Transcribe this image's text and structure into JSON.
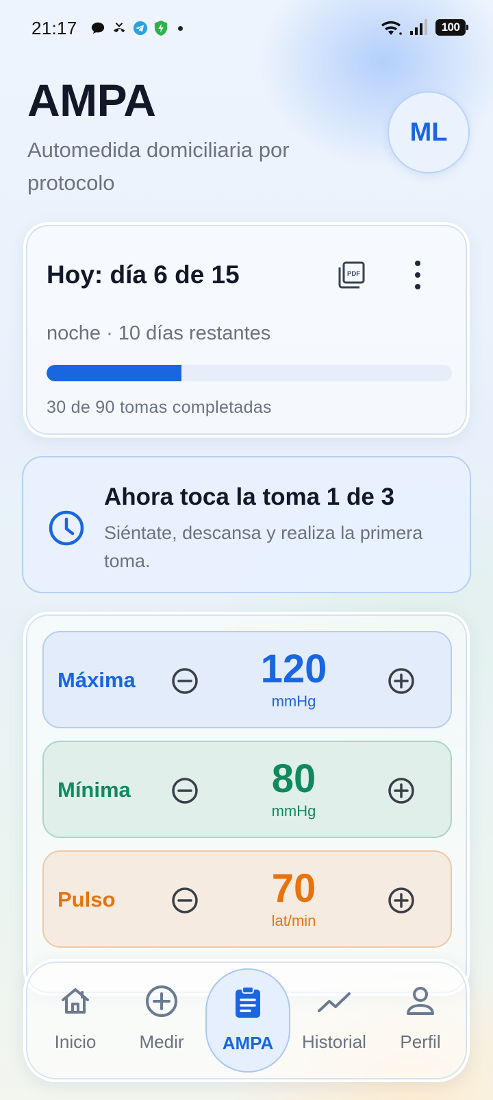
{
  "status_bar": {
    "time": "21:17",
    "battery": "100",
    "left_icons": [
      "chat-bubble-icon",
      "missed-call-icon",
      "telegram-icon",
      "shield-icon"
    ],
    "right_icons": [
      "wifi-icon",
      "signal-icon",
      "battery-icon"
    ]
  },
  "header": {
    "title": "AMPA",
    "subtitle": "Automedida domiciliaria por protocolo",
    "avatar_initials": "ML"
  },
  "progress_card": {
    "title": "Hoy: día 6 de 15",
    "status": "noche · 10 días restantes",
    "progress_fraction": 0.3333,
    "count_text": "30 de 90 tomas completadas",
    "pdf_icon": "pdf-icon",
    "more_icon": "more-vertical-icon"
  },
  "notice": {
    "title": "Ahora toca la toma 1 de 3",
    "text": "Siéntate, descansa y realiza la primera toma.",
    "icon": "clock-icon"
  },
  "measurements": [
    {
      "label": "Máxima",
      "value": "120",
      "unit": "mmHg",
      "color": "#1a66e0"
    },
    {
      "label": "Mínima",
      "value": "80",
      "unit": "mmHg",
      "color": "#0f8a5f"
    },
    {
      "label": "Pulso",
      "value": "70",
      "unit": "lat/min",
      "color": "#e8720c"
    }
  ],
  "nav": {
    "items": [
      {
        "label": "Inicio",
        "icon": "home-icon"
      },
      {
        "label": "Medir",
        "icon": "add-circle-icon"
      },
      {
        "label": "AMPA",
        "icon": "clipboard-icon"
      },
      {
        "label": "Historial",
        "icon": "trend-icon"
      },
      {
        "label": "Perfil",
        "icon": "person-icon"
      }
    ],
    "active": "AMPA"
  },
  "colors": {
    "accent": "#1a66e0",
    "green": "#0f8a5f",
    "orange": "#e8720c",
    "text_primary": "#111827",
    "text_secondary": "#6b7280"
  }
}
